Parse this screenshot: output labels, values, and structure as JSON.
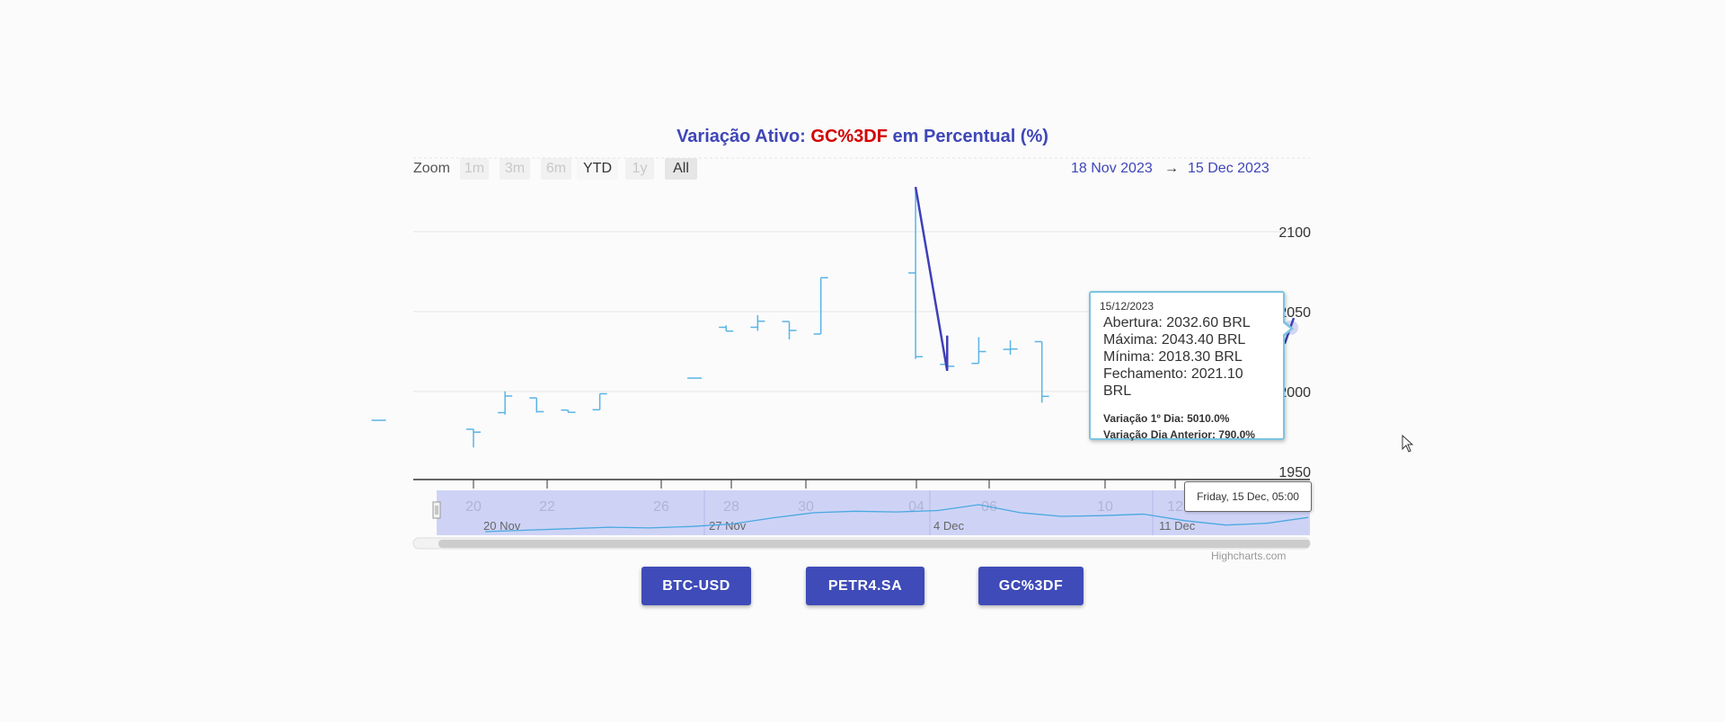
{
  "title": {
    "prefix": "Variação Ativo: ",
    "asset": "GC%3DF",
    "suffix": " em Percentual (%)"
  },
  "range_selector": {
    "zoom_label": "Zoom",
    "buttons": [
      {
        "label": "1m",
        "state": "disabled"
      },
      {
        "label": "3m",
        "state": "disabled"
      },
      {
        "label": "6m",
        "state": "disabled"
      },
      {
        "label": "YTD",
        "state": "enabled"
      },
      {
        "label": "1y",
        "state": "disabled"
      },
      {
        "label": "All",
        "state": "active"
      }
    ],
    "from": "18 Nov 2023",
    "arrow": "→",
    "to": "15 Dec 2023"
  },
  "chart_data": {
    "type": "ohlc",
    "x_unit": "date",
    "y_label_side": "right",
    "ylim": [
      1950,
      2100
    ],
    "y_ticks": [
      2100,
      2050,
      2000,
      1950
    ],
    "x_ticks": [
      "20",
      "22",
      "26",
      "28",
      "30",
      "04",
      "06",
      "10",
      "12"
    ],
    "navigator_labels": [
      "20 Nov",
      "27 Nov",
      "4 Dec",
      "11 Dec"
    ],
    "series": [
      {
        "name": "GC%3DF",
        "points": [
          {
            "x": "2023-11-17",
            "open": 1982.0,
            "high": 1982.0,
            "low": 1982.0,
            "close": 1982.0
          },
          {
            "x": "2023-11-20",
            "open": 1976.4,
            "high": 1976.4,
            "low": 1965.0,
            "close": 1974.6
          },
          {
            "x": "2023-11-21",
            "open": 1986.8,
            "high": 2000.2,
            "low": 1985.6,
            "close": 1997.2
          },
          {
            "x": "2023-11-22",
            "open": 1996.0,
            "high": 1996.0,
            "low": 1986.8,
            "close": 1987.4
          },
          {
            "x": "2023-11-23",
            "open": 1988.4,
            "high": 1988.4,
            "low": 1986.8,
            "close": 1987.0
          },
          {
            "x": "2023-11-24",
            "open": 1988.6,
            "high": 1998.6,
            "low": 1988.6,
            "close": 1998.6
          },
          {
            "x": "2023-11-27",
            "open": 2008.4,
            "high": 2008.4,
            "low": 2008.4,
            "close": 2008.4
          },
          {
            "x": "2023-11-28",
            "open": 2040.2,
            "high": 2041.4,
            "low": 2037.8,
            "close": 2037.8
          },
          {
            "x": "2023-11-29",
            "open": 2040.2,
            "high": 2047.8,
            "low": 2038.0,
            "close": 2044.0
          },
          {
            "x": "2023-11-30",
            "open": 2043.8,
            "high": 2043.8,
            "low": 2032.6,
            "close": 2038.2
          },
          {
            "x": "2023-12-01",
            "open": 2036.0,
            "high": 2071.2,
            "low": 2036.0,
            "close": 2071.2
          },
          {
            "x": "2023-12-04",
            "open": 2074.2,
            "high": 2128.0,
            "low": 2020.4,
            "close": 2021.8
          },
          {
            "x": "2023-12-05",
            "open": 2017.0,
            "high": 2034.6,
            "low": 2013.0,
            "close": 2015.8
          },
          {
            "x": "2023-12-06",
            "open": 2017.6,
            "high": 2034.0,
            "low": 2017.6,
            "close": 2025.0
          },
          {
            "x": "2023-12-07",
            "open": 2026.4,
            "high": 2032.0,
            "low": 2023.0,
            "close": 2026.6
          },
          {
            "x": "2023-12-08",
            "open": 2031.2,
            "high": 2031.2,
            "low": 1993.0,
            "close": 1997.0
          },
          {
            "x": "2023-12-15",
            "open": 2032.6,
            "high": 2043.4,
            "low": 2018.3,
            "close": 2021.1
          }
        ]
      }
    ],
    "navigator_series": [
      1982,
      1986,
      1990,
      1994,
      1992,
      1996,
      2003,
      2020,
      2034,
      2038,
      2036,
      2040,
      2056,
      2034,
      2024,
      2026,
      2030,
      2012,
      2000,
      2005,
      2021
    ]
  },
  "tooltip": {
    "date": "15/12/2023",
    "lines": [
      "Abertura: 2032.60 BRL",
      "Máxima: 2043.40 BRL",
      "Mínima: 2018.30 BRL",
      "Fechamento: 2021.10 BRL"
    ],
    "var_first": "Variação 1º Dia: 5010.0%",
    "var_prev": "Variação Dia Anterior: 790.0%"
  },
  "crosshair_label": "Friday, 15 Dec, 05:00",
  "credits": "Highcharts.com",
  "asset_buttons": [
    {
      "label": "BTC-USD"
    },
    {
      "label": "PETR4.SA"
    },
    {
      "label": "GC%3DF"
    }
  ],
  "colors": {
    "title": "#3f46b8",
    "asset": "#d30000",
    "ohlc": "#5ab4e6",
    "highlight": "#3f3fb8",
    "button": "#3f4bb8"
  }
}
